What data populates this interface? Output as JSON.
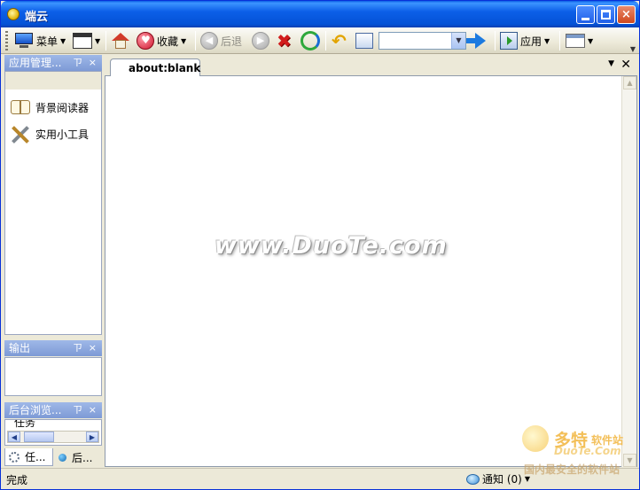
{
  "window": {
    "title": "端云",
    "controls": {
      "minimize": "minimize",
      "maximize": "maximize",
      "close": "×"
    }
  },
  "toolbar": {
    "menu_label": "菜单",
    "favorites_label": "收藏",
    "back_label": "后退",
    "address_value": "",
    "apps_label": "应用",
    "icons": [
      "monitor-icon",
      "window-icon",
      "home-icon",
      "heart-icon",
      "back-icon",
      "forward-icon",
      "stop-icon",
      "refresh-icon",
      "undo-icon",
      "clipboard-icon",
      "go-arrow-icon",
      "app-icon",
      "tab-cards-icon"
    ]
  },
  "sidebar": {
    "panel_app_manager": {
      "title": "应用管理...",
      "pin": "ㄗ",
      "close": "×"
    },
    "app_items": [
      {
        "label": "背景阅读器",
        "icon": "book-icon"
      },
      {
        "label": "实用小工具",
        "icon": "tools-icon"
      }
    ],
    "panel_output": {
      "title": "输出",
      "pin": "ㄗ",
      "close": "×"
    },
    "panel_bg_browse": {
      "title": "后台浏览...",
      "pin": "ㄗ",
      "close": "×",
      "column": "任务"
    },
    "bottom_tabs": [
      {
        "label": "任...",
        "icon": "gear-icon"
      },
      {
        "label": "后...",
        "icon": "globe-icon"
      }
    ]
  },
  "browser": {
    "tab_label": "about:blank",
    "watermark": "www.DuoTe.com"
  },
  "statusbar": {
    "status": "完成",
    "notify_label": "通知 (0)"
  },
  "corner_logo": {
    "brand": "多特",
    "brand_sub": "软件站",
    "domain": "DuoTe.Com",
    "slogan": "国内最安全的软件站"
  },
  "colors": {
    "titlebar": "#0452d6",
    "panel_header": "#7d9ad6",
    "chrome": "#ece9d8"
  }
}
